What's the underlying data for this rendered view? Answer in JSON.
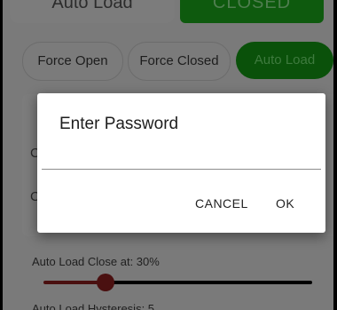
{
  "status": {
    "mode_label": "Auto Load",
    "state_label": "CLOSED"
  },
  "mode_buttons": {
    "force_open": "Force Open",
    "force_closed": "Force Closed",
    "auto_load": "Auto Load",
    "active": "auto_load"
  },
  "background_rows": [
    "C",
    "C"
  ],
  "auto_load_close": {
    "label": "Auto Load Close at: 30%",
    "value_percent": 30
  },
  "hysteresis": {
    "label": "Auto Load Hysteresis: 5"
  },
  "dialog": {
    "title": "Enter Password",
    "input_value": "",
    "cancel_label": "CANCEL",
    "ok_label": "OK"
  },
  "colors": {
    "accent_green": "#0e5a0e",
    "slider_red": "#4a1010",
    "dialog_bg": "#ffffff"
  }
}
